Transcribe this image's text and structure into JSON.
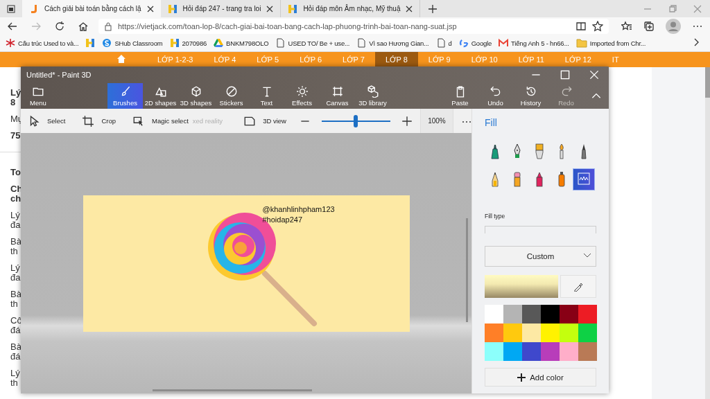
{
  "browser": {
    "tabs": [
      {
        "title": "Cách giải bài toán bằng cách lậ",
        "selected": true
      },
      {
        "title": "Hỏi đáp 247 - trang tra loi",
        "selected": false
      },
      {
        "title": "Hỏi đáp môn Âm nhạc, Mỹ thuậ",
        "selected": false
      }
    ],
    "url": "https://vietjack.com/toan-lop-8/cach-giai-bai-toan-bang-cach-lap-phuong-trinh-bai-toan-nang-suat.jsp",
    "bookmarks": [
      {
        "kind": "link",
        "title": "Cấu trúc Used to và..."
      },
      {
        "kind": "icon"
      },
      {
        "kind": "link",
        "title": "SHub Classroom"
      },
      {
        "kind": "link",
        "title": "2070986"
      },
      {
        "kind": "link",
        "title": "BNKM798OLO"
      },
      {
        "kind": "link",
        "title": "USED TO/ Be + use..."
      },
      {
        "kind": "link",
        "title": "Vì sao Hương Gian..."
      },
      {
        "kind": "link",
        "title": "d"
      },
      {
        "kind": "link",
        "title": "Google"
      },
      {
        "kind": "link",
        "title": "Tiếng Anh 5 - hn66..."
      },
      {
        "kind": "folder",
        "title": "Imported from Chr..."
      }
    ]
  },
  "site": {
    "nav": [
      {
        "label": "LỚP 1-2-3",
        "selected": false
      },
      {
        "label": "LỚP 4",
        "selected": false
      },
      {
        "label": "LỚP 5",
        "selected": false
      },
      {
        "label": "LỚP 6",
        "selected": false
      },
      {
        "label": "LỚP 7",
        "selected": false
      },
      {
        "label": "LỚP 8",
        "selected": true
      },
      {
        "label": "LỚP 9",
        "selected": false
      },
      {
        "label": "LỚP 10",
        "selected": false
      },
      {
        "label": "LỚP 11",
        "selected": false
      },
      {
        "label": "LỚP 12",
        "selected": false
      },
      {
        "label": "IT",
        "selected": false
      }
    ],
    "paragraphs": [
      {
        "lines": [
          "Lý",
          "8"
        ],
        "bold": true
      },
      {
        "lines": [
          "Mụ"
        ],
        "bold": false
      },
      {
        "lines": [
          "75"
        ],
        "bold": true
      },
      {
        "lines": [
          "To"
        ],
        "bold": true
      },
      {
        "lines": [
          "Ch",
          "ch"
        ],
        "bold": true
      },
      {
        "lines": [
          "Lý",
          "đa"
        ],
        "bold": false
      },
      {
        "lines": [
          "Bà",
          "th"
        ],
        "bold": false
      },
      {
        "lines": [
          "Lý",
          "đa"
        ],
        "bold": false
      },
      {
        "lines": [
          "Bà",
          "th"
        ],
        "bold": false
      },
      {
        "lines": [
          "Cô",
          "đá"
        ],
        "bold": false
      },
      {
        "lines": [
          "Bà",
          "đá"
        ],
        "bold": false
      },
      {
        "lines": [
          "Lý",
          "th"
        ],
        "bold": false
      }
    ]
  },
  "paint": {
    "title": "Untitled* - Paint 3D",
    "menu": "Menu",
    "tools": [
      {
        "label": "Brushes",
        "selected": true
      },
      {
        "label": "2D shapes",
        "selected": false
      },
      {
        "label": "3D shapes",
        "selected": false
      },
      {
        "label": "Stickers",
        "selected": false
      },
      {
        "label": "Text",
        "selected": false
      },
      {
        "label": "Effects",
        "selected": false
      },
      {
        "label": "Canvas",
        "selected": false
      },
      {
        "label": "3D library",
        "selected": false
      }
    ],
    "actions": [
      {
        "label": "Paste",
        "disabled": false
      },
      {
        "label": "Undo",
        "disabled": false
      },
      {
        "label": "History",
        "disabled": false
      },
      {
        "label": "Redo",
        "disabled": true
      }
    ],
    "subtools": [
      {
        "label": "Select",
        "disabled": false
      },
      {
        "label": "Crop",
        "disabled": false
      },
      {
        "label": "Magic select",
        "disabled": false
      },
      {
        "label": "xed reality",
        "disabled": true
      },
      {
        "label": "3D view",
        "disabled": false
      }
    ],
    "zoom": {
      "level": 0.5,
      "reading": "100%"
    },
    "canvas_texts": [
      "@khanhlinhpham123",
      "#hoidap247"
    ],
    "panel": {
      "title": "Fill",
      "brushes": [
        {
          "selected": false
        },
        {
          "selected": false
        },
        {
          "selected": false
        },
        {
          "selected": false
        },
        {
          "selected": false
        },
        {
          "selected": false
        },
        {
          "selected": false
        },
        {
          "selected": false
        },
        {
          "selected": false
        },
        {
          "selected": true
        }
      ],
      "fill_type_label": "Fill type",
      "dropdown": "Custom",
      "palette": [
        {
          "color": "#ffffff"
        },
        {
          "color": "#b4b4b4"
        },
        {
          "color": "#585858"
        },
        {
          "color": "#000000"
        },
        {
          "color": "#880015"
        },
        {
          "color": "#ed1c24"
        },
        {
          "color": "#ff7f27"
        },
        {
          "color": "#ffc90e"
        },
        {
          "color": "#fde9a4"
        },
        {
          "color": "#fff200"
        },
        {
          "color": "#c4ff0e"
        },
        {
          "color": "#0ed145"
        },
        {
          "color": "#8cfffb"
        },
        {
          "color": "#00a8f3"
        },
        {
          "color": "#3f48cc"
        },
        {
          "color": "#b83dba"
        },
        {
          "color": "#ffaec9"
        },
        {
          "color": "#b97a56"
        }
      ],
      "add_color": "Add color"
    }
  }
}
